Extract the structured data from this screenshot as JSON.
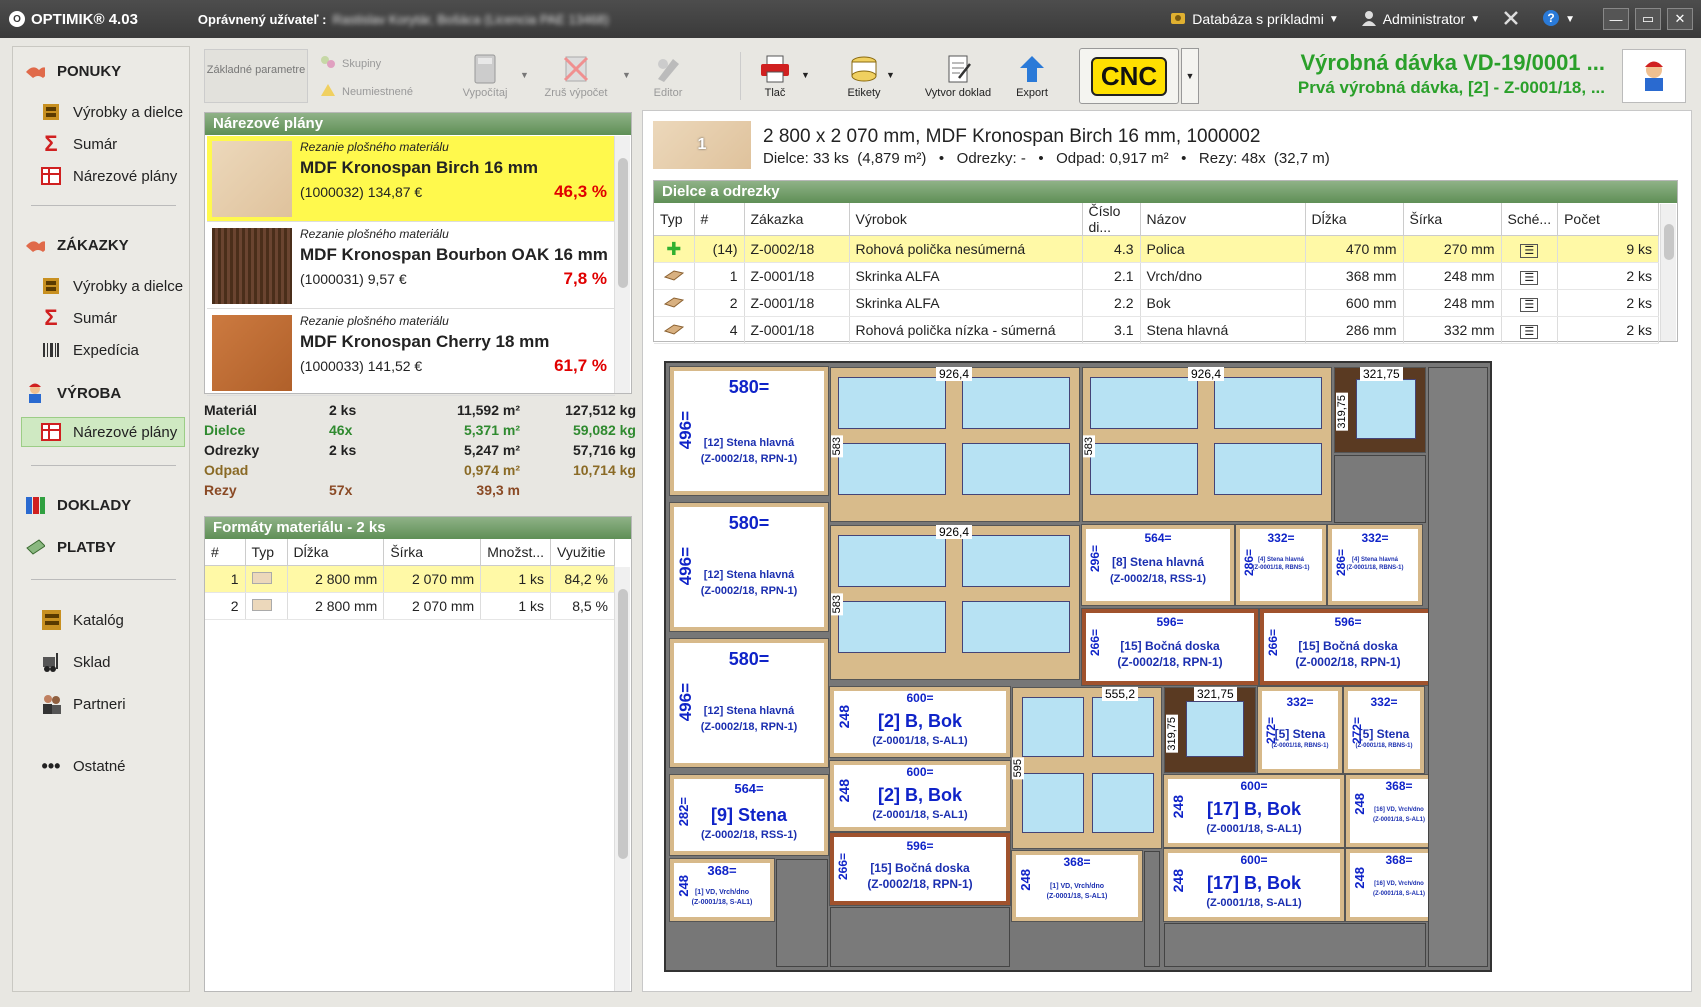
{
  "window": {
    "app_title": "OPTIMIK® 4.03",
    "user_label": "Oprávnený užívateľ :",
    "user_value": "Rastislav Korytár, Bošáca (Licencia PAE 13468)",
    "database": "Databáza s príkladmi",
    "admin": "Administrator"
  },
  "sidebar": {
    "ponuky": "PONUKY",
    "ponuky_items": [
      "Výrobky a dielce",
      "Sumár",
      "Nárezové plány"
    ],
    "zakazky": "ZÁKAZKY",
    "zakazky_items": [
      "Výrobky a dielce",
      "Sumár",
      "Expedícia"
    ],
    "vyroba": "VÝROBA",
    "vyroba_active": "Nárezové plány",
    "doklady": "DOKLADY",
    "platby": "PLATBY",
    "katalog": "Katalóg",
    "sklad": "Sklad",
    "partneri": "Partneri",
    "ostatne": "Ostatné"
  },
  "toolbar": {
    "zakladne": "Základné parametre",
    "skupiny": "Skupiny",
    "neumiestnene": "Neumiestnené",
    "vypocitaj": "Vypočítaj",
    "zrus": "Zruš výpočet",
    "editor": "Editor",
    "tlac": "Tlač",
    "etikety": "Etikety",
    "vytvor": "Vytvor doklad",
    "export": "Export",
    "cnc": "CNC"
  },
  "batch": {
    "title": "Výrobná dávka VD-19/0001 ...",
    "subtitle": "Prvá výrobná dávka, [2] - Z-0001/18, ..."
  },
  "plans": {
    "header": "Nárezové plány",
    "items": [
      {
        "sub": "Rezanie plošného materiálu",
        "name": "MDF Kronospan Birch 16 mm",
        "code": "(1000032)  134,87 €",
        "pct": "46,3 %",
        "color": "#e9d3b4"
      },
      {
        "sub": "Rezanie plošného materiálu",
        "name": "MDF Kronospan Bourbon OAK 16 mm",
        "code": "(1000031)  9,57 €",
        "pct": "7,8 %",
        "color": "#5a3a22"
      },
      {
        "sub": "Rezanie plošného materiálu",
        "name": "MDF Kronospan Cherry 18 mm",
        "code": "(1000033)  141,52 €",
        "pct": "61,7 %",
        "color": "#c4743a"
      }
    ]
  },
  "stats": {
    "rows": [
      {
        "label": "Materiál",
        "count": "2 ks",
        "area": "11,592 m²",
        "weight": "127,512 kg",
        "color": "#222"
      },
      {
        "label": "Dielce",
        "count": "46x",
        "area": "5,371 m²",
        "weight": "59,082 kg",
        "color": "#2f8a2f"
      },
      {
        "label": "Odrezky",
        "count": "2 ks",
        "area": "5,247 m²",
        "weight": "57,716 kg",
        "color": "#222"
      },
      {
        "label": "Odpad",
        "count": "",
        "area": "0,974 m²",
        "weight": "10,714 kg",
        "color": "#8a6a25"
      },
      {
        "label": "Rezy",
        "count": "57x",
        "area": "39,3 m",
        "weight": "",
        "color": "#8a4a25"
      }
    ]
  },
  "formats": {
    "header": "Formáty materiálu - 2 ks",
    "columns": [
      "#",
      "Typ",
      "Dĺžka",
      "Šírka",
      "Množst...",
      "Využitie"
    ],
    "rows": [
      [
        "1",
        "",
        "2 800 mm",
        "2 070 mm",
        "1 ks",
        "84,2 %"
      ],
      [
        "2",
        "",
        "2 800 mm",
        "2 070 mm",
        "1 ks",
        "8,5 %"
      ]
    ]
  },
  "sheet": {
    "number": "1",
    "title": "2 800 x 2 070 mm, MDF Kronospan Birch 16 mm, 1000002",
    "info": "Dielce: 33 ks  (4,879 m²)   •   Odrezky: -   •   Odpad: 0,917 m²   •   Rezy: 48x  (32,7 m)"
  },
  "parts": {
    "header": "Dielce a odrezky",
    "columns": [
      "Typ",
      "#",
      "Zákazka",
      "Výrobok",
      "Číslo di...",
      "Názov",
      "Dĺžka",
      "Šírka",
      "Sché...",
      "Počet"
    ],
    "rows": [
      [
        "",
        "(14)",
        "Z-0002/18",
        "Rohová polička nesúmerná",
        "4.3",
        "Polica",
        "470 mm",
        "270 mm",
        "",
        "9 ks"
      ],
      [
        "",
        "1",
        "Z-0001/18",
        "Skrinka ALFA",
        "2.1",
        "Vrch/dno",
        "368 mm",
        "248 mm",
        "",
        "2 ks"
      ],
      [
        "",
        "2",
        "Z-0001/18",
        "Skrinka ALFA",
        "2.2",
        "Bok",
        "600 mm",
        "248 mm",
        "",
        "2 ks"
      ],
      [
        "",
        "4",
        "Z-0001/18",
        "Rohová polička nízka - súmerná",
        "3.1",
        "Stena hlavná",
        "286 mm",
        "332 mm",
        "",
        "2 ks"
      ]
    ]
  },
  "canvas": {
    "d580": "580=",
    "d496": "496=",
    "stena12": "[12]  Stena hlavná",
    "rpn": "(Z-0002/18, RPN-1)",
    "d9264": "926,4",
    "d583": "583",
    "d32175": "321,75",
    "d31975": "319,75",
    "d5552": "555,2",
    "d595": "595",
    "d564": "564=",
    "d296": "296=",
    "stena8": "[8]  Stena hlavná",
    "rss": "(Z-0002/18, RSS-1)",
    "d332": "332=",
    "d286": "286=",
    "stena4": "[4]  Stena hlavná",
    "rbns": "(Z-0001/18, RBNS-1)",
    "d596": "596=",
    "d266": "266=",
    "bocna15": "[15]  Bočná doska",
    "rpn1": "(Z-0002/18, RPN-1)",
    "d600": "600=",
    "d248": "248",
    "bok2": "[2]  B, Bok",
    "sal1": "(Z-0001/18, S-AL1)",
    "d272": "272=",
    "stena5": "[5]  Stena",
    "rbns5": "(Z-0001/18, RBNS-1)",
    "d5642": "564=",
    "d282": "282=",
    "stena9": "[9]  Stena",
    "rss9": "(Z-0002/18, RSS-1)",
    "d368": "368=",
    "vd1": "[1]  VD, Vrch/dno",
    "sal1b": "(Z-0001/18, S-AL1)",
    "bok17": "[17]  B, Bok",
    "vd16": "[16]  VD, Vrch/dno"
  }
}
